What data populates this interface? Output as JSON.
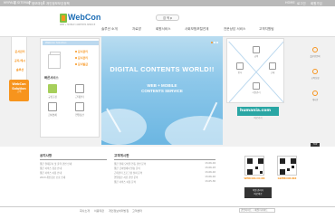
{
  "topbar": {
    "links": [
      "MYPAGE",
      "SITEMAP",
      "정보마당",
      "개인정보보호정책"
    ],
    "right_links": [
      "HOME",
      "로그인",
      "회원가입"
    ]
  },
  "header": {
    "logo_text": "WebCon",
    "logo_sub": "WEB + MOBILE CONTENTS SERVICE",
    "search_label": "검 색  ρ",
    "nav": [
      "솔루션 소개",
      "자료방",
      "회원서비스",
      "사회보험포털연계",
      "전문상담 서비스",
      "고객지원팀"
    ]
  },
  "side_left": {
    "items": [
      "문서관리",
      "공지/게시",
      "솔루션"
    ],
    "badge_title": "WebCon Solution",
    "badge_sub": "고객"
  },
  "panel_left": {
    "head": "Webcon Solution",
    "doc_buttons": [
      "문서관리",
      "문서관리",
      "문서발급"
    ],
    "service_title": "빠른서비스",
    "services": [
      "규정고정",
      "근태관리",
      "급여명세",
      "연말정산"
    ]
  },
  "banner": {
    "title": "DIGITAL CONTENTS WORLD!!",
    "sub_line1": "WEB + MOBILE",
    "sub_line2": "CONTENTS SERVICE"
  },
  "panel_right": {
    "labels": [
      "인사",
      "급여",
      "근태",
      "사원관리"
    ]
  },
  "humania": {
    "text": "humania.com",
    "sub": "바로가기"
  },
  "side_right": {
    "items": [
      "솔루션문의",
      "교육신청",
      "게시판"
    ],
    "top_label": "TOP"
  },
  "notice": {
    "title": "공지사항",
    "rows": [
      "웹콘 결재문서 및 출력 관련 안내",
      "웹콘 서비스 점검 안내",
      "웹콘 서비스 이용 안내",
      "2013 개인정보 보호 안내"
    ]
  },
  "free": {
    "title": "고객게시판",
    "rows": [
      {
        "text": "웹콘 결재 모바일 연동 관련 문의",
        "date": "13-06-04"
      },
      {
        "text": "웹콘 급여명세서 발송 문의",
        "date": "13-06-03"
      },
      {
        "text": "근태관리 프로그램 설치 문의",
        "date": "13-06-02"
      },
      {
        "text": "연말정산 서류 관련 문의",
        "date": "13-06-02"
      },
      {
        "text": "웹콘 서비스 이용 문의",
        "date": "13-05-30"
      }
    ]
  },
  "qr": {
    "left_label": "WEBCON.CO.KR",
    "right_label": "GWEBCON.BIZ"
  },
  "small_banner": {
    "line1": "직원 관리가",
    "line2": "바로바로"
  },
  "footer": {
    "links": [
      "회사소개",
      "이용약관",
      "개인정보처리방침",
      "고객센터"
    ],
    "select_value": "관련사이트 :: 패밀리사이트"
  },
  "colors": {
    "accent": "#f7941d",
    "brand": "#1c6db5",
    "banner": "#8ec8ea"
  }
}
